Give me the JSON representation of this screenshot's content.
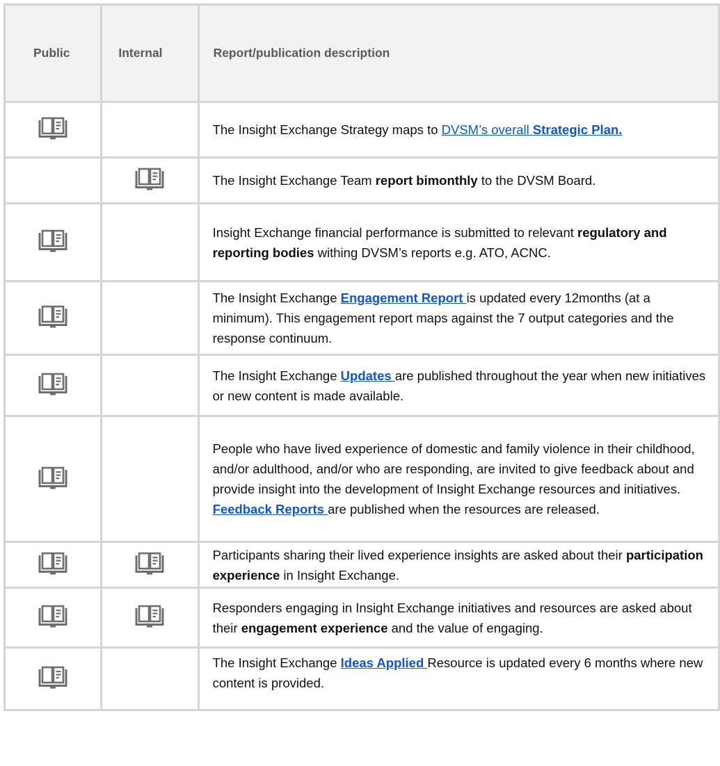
{
  "table": {
    "headers": {
      "public": "Public",
      "internal": "Internal",
      "description": "Report/publication description"
    },
    "icon": "book-report-icon",
    "colors": {
      "link": "#1155cc",
      "icon": "#6e6e6e",
      "border": "#d5d5d5",
      "header_bg": "#f2f2f2"
    },
    "rows": [
      {
        "public": true,
        "internal": false,
        "segments": [
          {
            "t": "The Insight Exchange Strategy maps to "
          },
          {
            "t": "DVSM’s overall ",
            "link": true
          },
          {
            "t": "Strategic Plan.",
            "link": true,
            "bold": true
          }
        ]
      },
      {
        "public": false,
        "internal": true,
        "segments": [
          {
            "t": "The Insight Exchange Team "
          },
          {
            "t": "report bimonthly",
            "bold": true
          },
          {
            "t": " to the DVSM Board."
          }
        ]
      },
      {
        "public": true,
        "internal": false,
        "segments": [
          {
            "t": "Insight Exchange financial performance is submitted to relevant "
          },
          {
            "t": "regulatory and reporting bodies",
            "bold": true
          },
          {
            "t": " withing DVSM’s reports e.g. ATO, ACNC."
          }
        ]
      },
      {
        "public": true,
        "internal": false,
        "segments": [
          {
            "t": "The Insight Exchange "
          },
          {
            "t": "Engagement Report ",
            "link": true,
            "bold": true
          },
          {
            "t": "is updated every 12months (at a minimum). This engagement report maps against the 7 output categories and the response continuum."
          }
        ]
      },
      {
        "public": true,
        "internal": false,
        "segments": [
          {
            "t": "The Insight Exchange "
          },
          {
            "t": "Updates ",
            "link": true,
            "bold": true
          },
          {
            "t": "are published throughout the year when new initiatives or new content is made available."
          }
        ]
      },
      {
        "public": true,
        "internal": false,
        "segments": [
          {
            "t": "People who have lived experience of domestic and family violence in their childhood, and/or adulthood, and/or who are responding, are invited to give feedback about and provide insight into the development of Insight Exchange resources and initiatives. "
          },
          {
            "t": "Feedback Reports ",
            "link": true,
            "bold": true
          },
          {
            "t": "are published when the resources are released."
          }
        ]
      },
      {
        "public": true,
        "internal": true,
        "segments": [
          {
            "t": "Participants sharing their lived experience insights are asked about their "
          },
          {
            "t": "participation experience",
            "bold": true
          },
          {
            "t": " in Insight Exchange."
          }
        ]
      },
      {
        "public": true,
        "internal": true,
        "segments": [
          {
            "t": "Responders engaging in Insight Exchange initiatives and resources are asked about their "
          },
          {
            "t": "engagement experience",
            "bold": true
          },
          {
            "t": " and the value of engaging."
          }
        ]
      },
      {
        "public": true,
        "internal": false,
        "segments": [
          {
            "t": "The Insight Exchange "
          },
          {
            "t": "Ideas Applied ",
            "link": true,
            "bold": true
          },
          {
            "t": "Resource is updated every 6 months where new content is provided."
          }
        ]
      }
    ]
  }
}
